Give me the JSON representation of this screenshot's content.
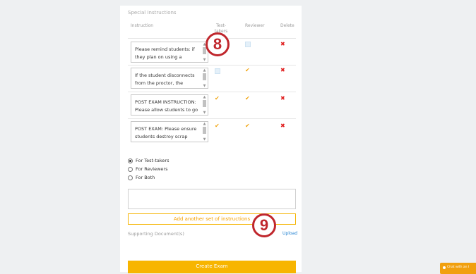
{
  "section": {
    "title": "Special Instructions",
    "headers": {
      "instruction": "Instruction",
      "test_takers": "Test-takers",
      "reviewer": "Reviewer",
      "delete": "Delete"
    }
  },
  "instructions": [
    {
      "text": "Please remind students: if they plan on using a whiteboard,",
      "test_takers": "badge",
      "reviewer": "unchecked"
    },
    {
      "text": "If the student disconnects from the proctor, the proctor",
      "test_takers": "unchecked",
      "reviewer": "checked"
    },
    {
      "text": "POST EXAM INSTRUCTION: Please allow students to go",
      "test_takers": "checked",
      "reviewer": "checked"
    },
    {
      "text": "POST EXAM: Please ensure students destroy scrap paper",
      "test_takers": "checked",
      "reviewer": "checked"
    }
  ],
  "audience": {
    "options": [
      "For Test-takers",
      "For Reviewers",
      "For Both"
    ],
    "selected": "For Test-takers"
  },
  "new_instruction": {
    "value": ""
  },
  "add_button": "Add another set of instructions",
  "supporting": {
    "label": "Supporting Document(s)",
    "upload": "Upload"
  },
  "create_button": "Create Exam",
  "annotations": {
    "badge_8": "8",
    "badge_9": "9"
  },
  "chat": {
    "label": "Chat with an I"
  },
  "colors": {
    "accent": "#f5b400",
    "delete": "#e02020",
    "annotation": "#c0272d",
    "link": "#1e7fd0"
  }
}
